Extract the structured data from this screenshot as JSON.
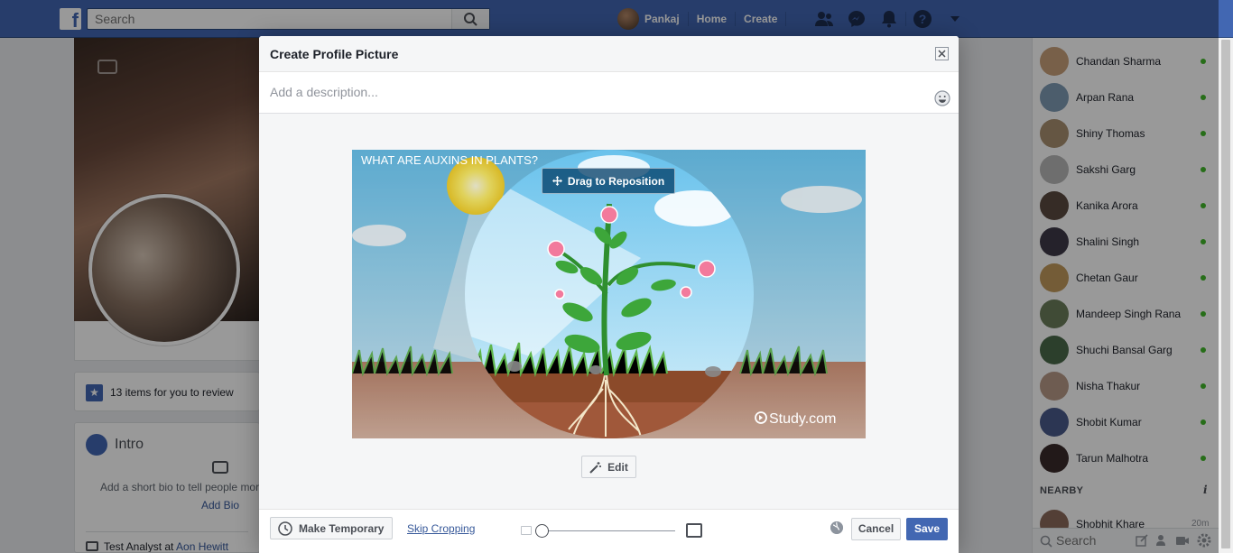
{
  "topbar": {
    "search_placeholder": "Search",
    "user_name": "Pankaj",
    "home_label": "Home",
    "create_label": "Create",
    "brand_color": "#4267b2"
  },
  "profile": {
    "review_text": "13 items for you to review",
    "intro_title": "Intro",
    "bio_prompt": "Add a short bio to tell people more",
    "add_bio_link": "Add Bio",
    "job_title": "Test Analyst at ",
    "job_company": "Aon Hewitt"
  },
  "dialog": {
    "title": "Create Profile Picture",
    "description_placeholder": "Add a description...",
    "image_caption": "WHAT ARE AUXINS IN PLANTS?",
    "image_watermark": "Study.com",
    "drag_label": "Drag to Reposition",
    "edit_label": "Edit",
    "make_temporary_label": "Make Temporary",
    "skip_cropping_label": "Skip Cropping",
    "zoom_level": 0,
    "cancel_label": "Cancel",
    "save_label": "Save"
  },
  "chat": {
    "contacts": [
      {
        "name": "Chandan Sharma",
        "color": "#c9a07a"
      },
      {
        "name": "Arpan Rana",
        "color": "#7f9bb5"
      },
      {
        "name": "Shiny Thomas",
        "color": "#a89070"
      },
      {
        "name": "Sakshi Garg",
        "color": "#b8b8b8"
      },
      {
        "name": "Kanika Arora",
        "color": "#5a4a40"
      },
      {
        "name": "Shalini Singh",
        "color": "#3e3a48"
      },
      {
        "name": "Chetan Gaur",
        "color": "#c29a5c"
      },
      {
        "name": "Mandeep Singh Rana",
        "color": "#6b7d5a"
      },
      {
        "name": "Shuchi Bansal Garg",
        "color": "#4a6a4a"
      },
      {
        "name": "Nisha Thakur",
        "color": "#b89a88"
      },
      {
        "name": "Shobit Kumar",
        "color": "#4a5a8a"
      },
      {
        "name": "Tarun Malhotra",
        "color": "#3a2a2a"
      }
    ],
    "nearby_heading": "NEARBY",
    "nearby_contact": "Shobhit Khare",
    "nearby_time": "20m",
    "search_placeholder": "Search",
    "online_color": "#42b72a"
  }
}
